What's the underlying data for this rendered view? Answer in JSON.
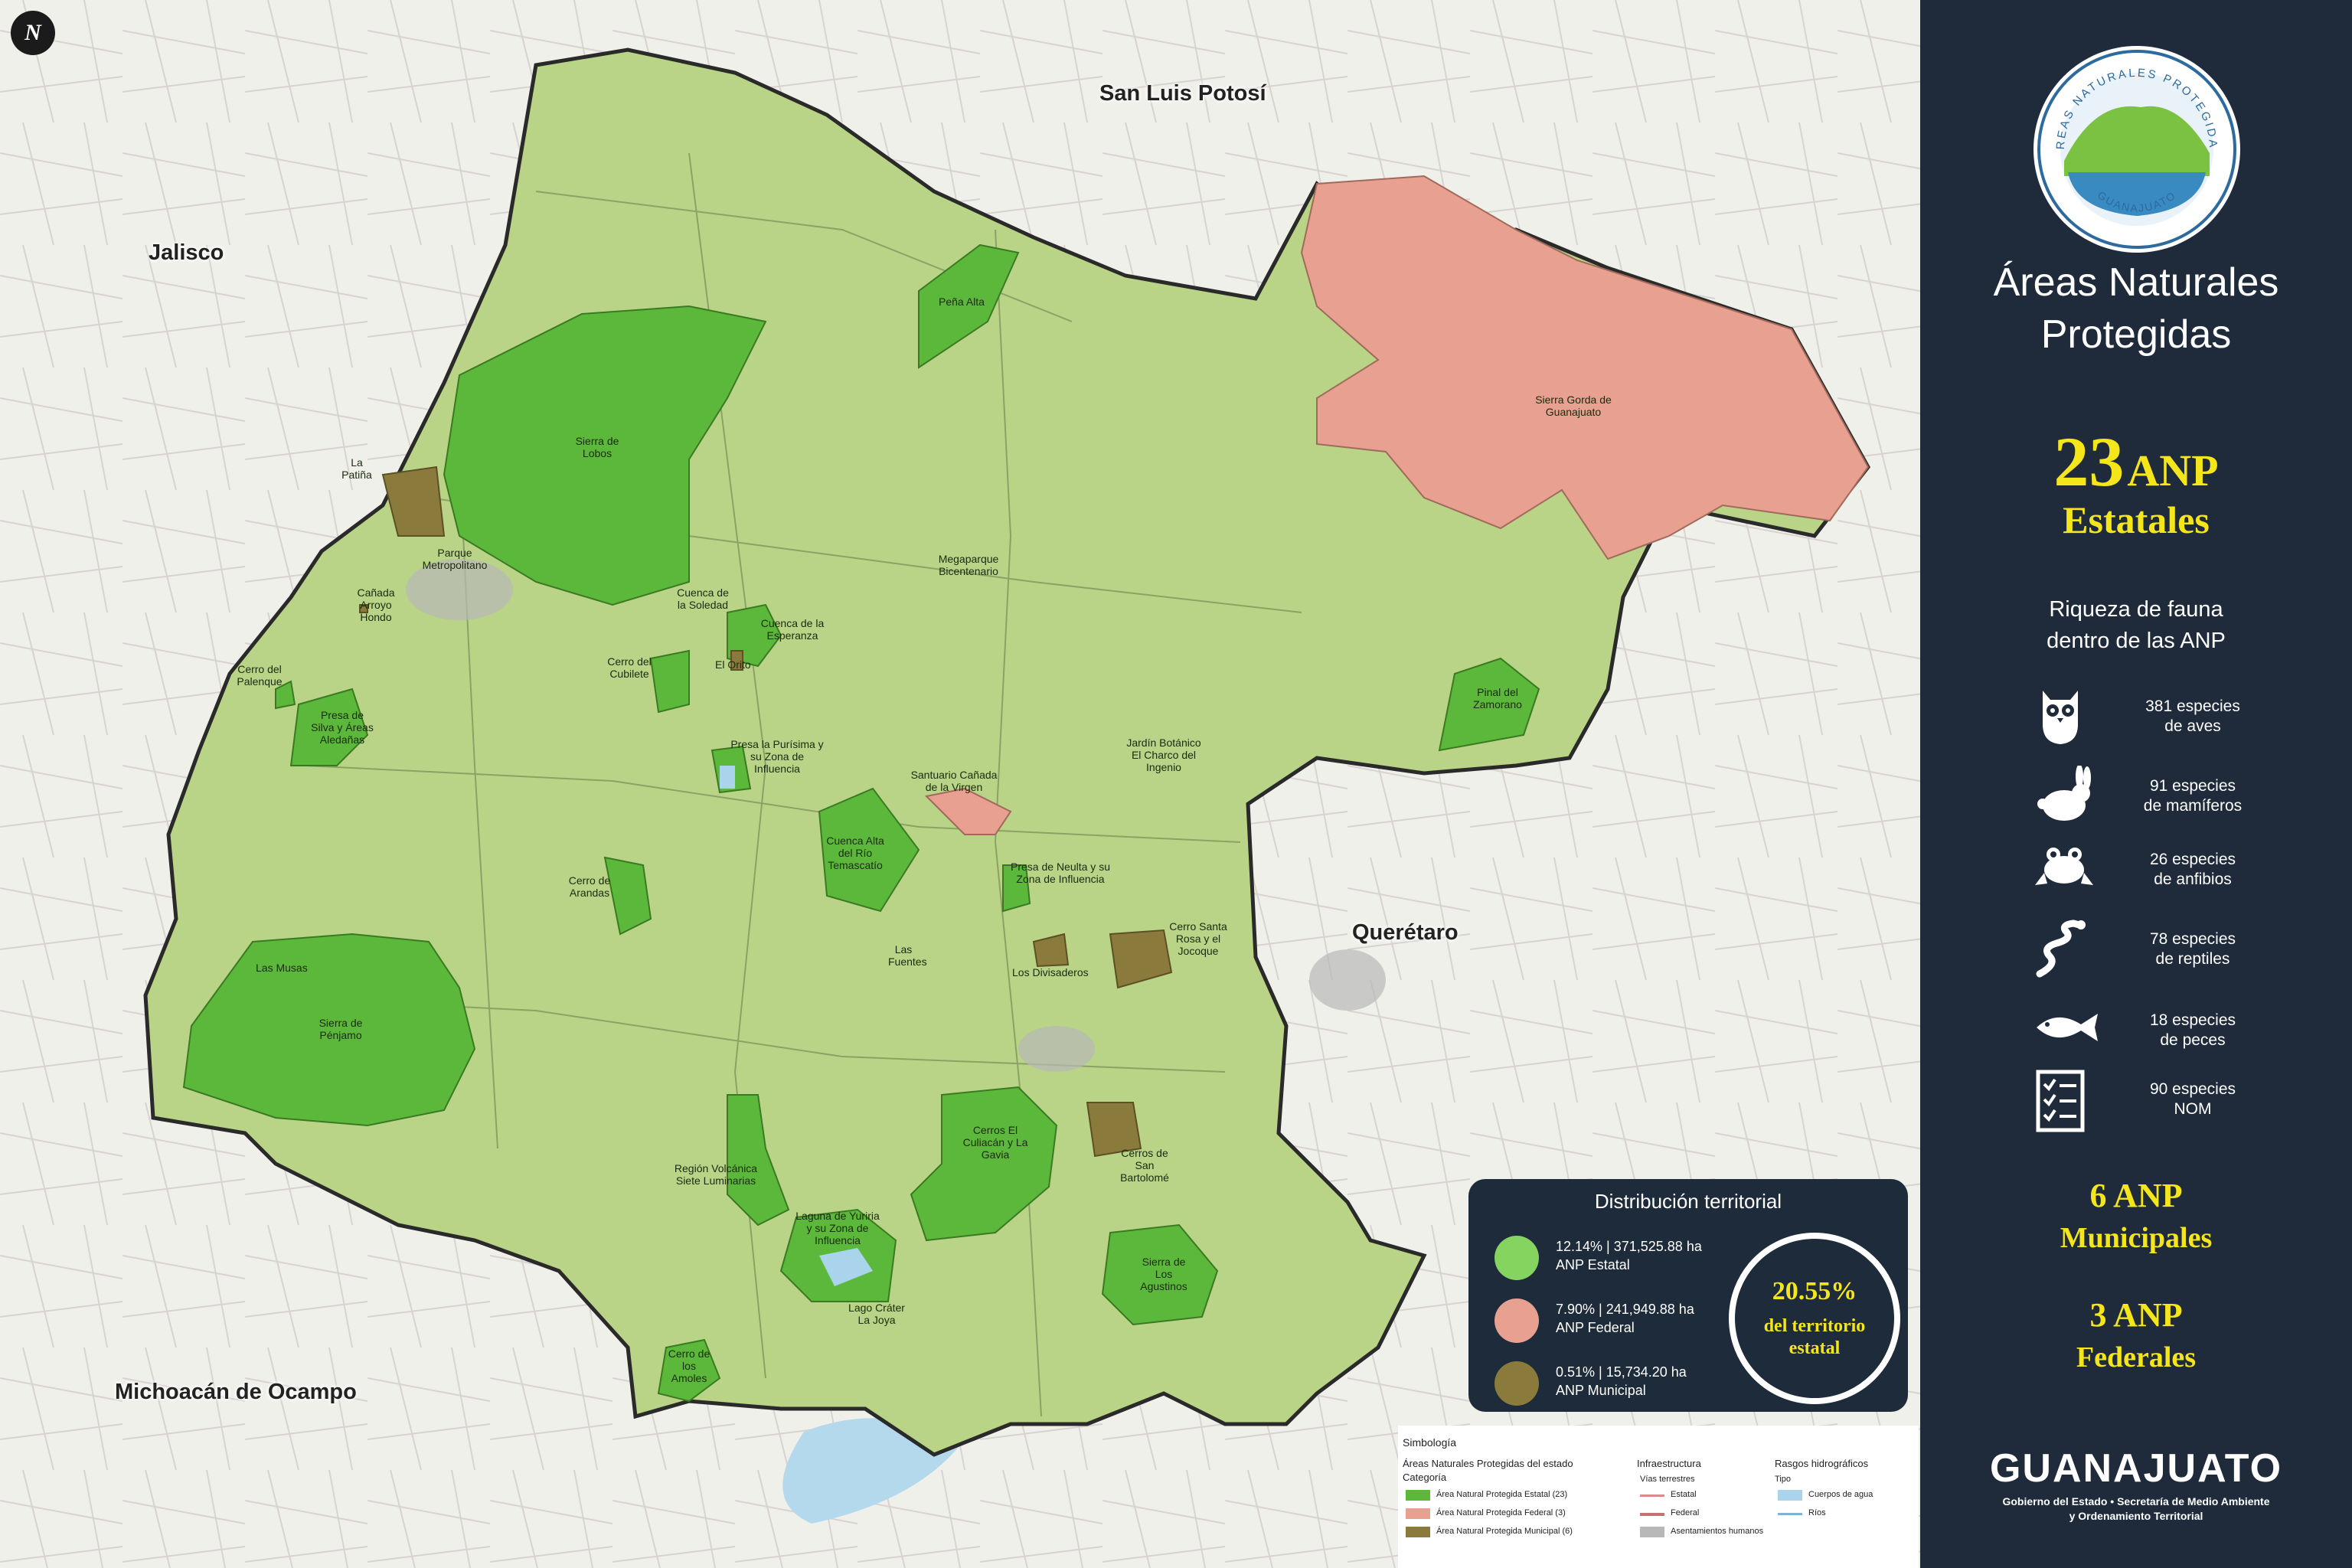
{
  "map": {
    "neighbors": {
      "san_luis_potosi": "San Luis Potosí",
      "jalisco": "Jalisco",
      "queretaro": "Querétaro",
      "michoacan": "Michoacán de Ocampo"
    },
    "north_symbol": "N",
    "anp_labels": {
      "sierra_lobos": "Sierra de Lobos",
      "pena_alta": "Peña Alta",
      "sierra_gorda": "Sierra Gorda de Guanajuato",
      "megaparque": "Megaparque Bicentenario",
      "la_patina": "La Patiña",
      "parque_metropolitano": "Parque Metropolitano",
      "canada_arroyo_hondo": "Cañada Arroyo Hondo",
      "cerro_palenque": "Cerro del Palenque",
      "presa_silva": "Presa de Silva y Áreas Aledañas",
      "cuenca_soledad": "Cuenca de la Soledad",
      "cuenca_esperanza": "Cuenca de la Esperanza",
      "cerro_cubilete": "Cerro del Cubilete",
      "el_orito": "El Orito",
      "presa_purisima": "Presa la Purísima y su Zona de Influencia",
      "pinal_zamorano": "Pinal del Zamorano",
      "jardin_botanico": "Jardín Botánico El Charco del Ingenio",
      "santuario_canada": "Santuario Cañada de la Virgen",
      "cuenca_temascatio": "Cuenca Alta del Río Temascatío",
      "presa_neulta": "Presa de Neulta y su Zona de Influencia",
      "cerro_arandas": "Cerro de Arandas",
      "las_fuentes": "Las Fuentes",
      "los_divisaderos": "Los Divisaderos",
      "cerro_santa_rosa": "Cerro Santa Rosa y el Jocoque",
      "las_musas": "Las Musas",
      "sierra_penjamo": "Sierra de Pénjamo",
      "cerros_culiacan": "Cerros El Culiacán y La Gavia",
      "region_volcanica": "Región Volcánica Siete Luminarias",
      "cerros_san_bartolome": "Cerros de San Bartolomé",
      "laguna_yuriria": "Laguna de Yuriria y su Zona de Influencia",
      "sierra_agustinos": "Sierra de Los Agustinos",
      "lago_crater": "Lago Cráter La Joya",
      "cerro_amoles": "Cerro de los Amoles"
    }
  },
  "distribution": {
    "title": "Distribución territorial",
    "rows": [
      {
        "line1": "12.14% | 371,525.88 ha",
        "line2": "ANP Estatal",
        "color": "#86d460"
      },
      {
        "line1": "7.90% | 241,949.88 ha",
        "line2": "ANP Federal",
        "color": "#e8a090"
      },
      {
        "line1": "0.51% | 15,734.20 ha",
        "line2": "ANP Municipal",
        "color": "#8a7a3c"
      }
    ],
    "total_pct": "20.55%",
    "total_line1": "del territorio",
    "total_line2": "estatal"
  },
  "legend": {
    "title": "Simbología",
    "col1_title": "Áreas Naturales Protegidas del estado",
    "col1_sub": "Categoría",
    "items": [
      {
        "label": "Área Natural Protegida Estatal (23)",
        "color": "#5cb83a"
      },
      {
        "label": "Área Natural Protegida Federal (3)",
        "color": "#e8a090"
      },
      {
        "label": "Área Natural Protegida Municipal (6)",
        "color": "#8a7a3c"
      }
    ],
    "col2_title": "Infraestructura",
    "col2_sub": "Vías terrestres",
    "road_state": "Estatal",
    "road_federal": "Federal",
    "settlements": "Asentamientos humanos",
    "col3_title": "Rasgos hidrográficos",
    "col3_sub": "Tipo",
    "water": "Cuerpos de agua",
    "rivers": "Ríos"
  },
  "panel": {
    "logo_top_text": "ÁREAS NATURALES PROTEGIDAS",
    "logo_bottom_text": "GUANAJUATO",
    "title_line1": "Áreas Naturales",
    "title_line2": "Protegidas",
    "state_count": "23",
    "state_anp": "ANP",
    "state_label": "Estatales",
    "fauna_title_line1": "Riqueza de fauna",
    "fauna_title_line2": "dentro de las  ANP",
    "fauna": [
      {
        "icon": "owl-icon",
        "line1": "381 especies",
        "line2": "de aves"
      },
      {
        "icon": "rabbit-icon",
        "line1": "91 especies",
        "line2": "de mamíferos"
      },
      {
        "icon": "frog-icon",
        "line1": "26 especies",
        "line2": "de anfibios"
      },
      {
        "icon": "snake-icon",
        "line1": "78 especies",
        "line2": "de reptiles"
      },
      {
        "icon": "fish-icon",
        "line1": "18 especies",
        "line2": "de peces"
      },
      {
        "icon": "checklist-icon",
        "line1": "90 especies",
        "line2": "NOM"
      }
    ],
    "municipal_line1": "6 ANP",
    "municipal_line2": "Municipales",
    "federal_line1": "3 ANP",
    "federal_line2": "Federales",
    "brand": "GUANAJUATO",
    "brand_sub_line1": "Gobierno del Estado  •  Secretaría de Medio Ambiente",
    "brand_sub_line2": "y Ordenamiento Territorial"
  }
}
